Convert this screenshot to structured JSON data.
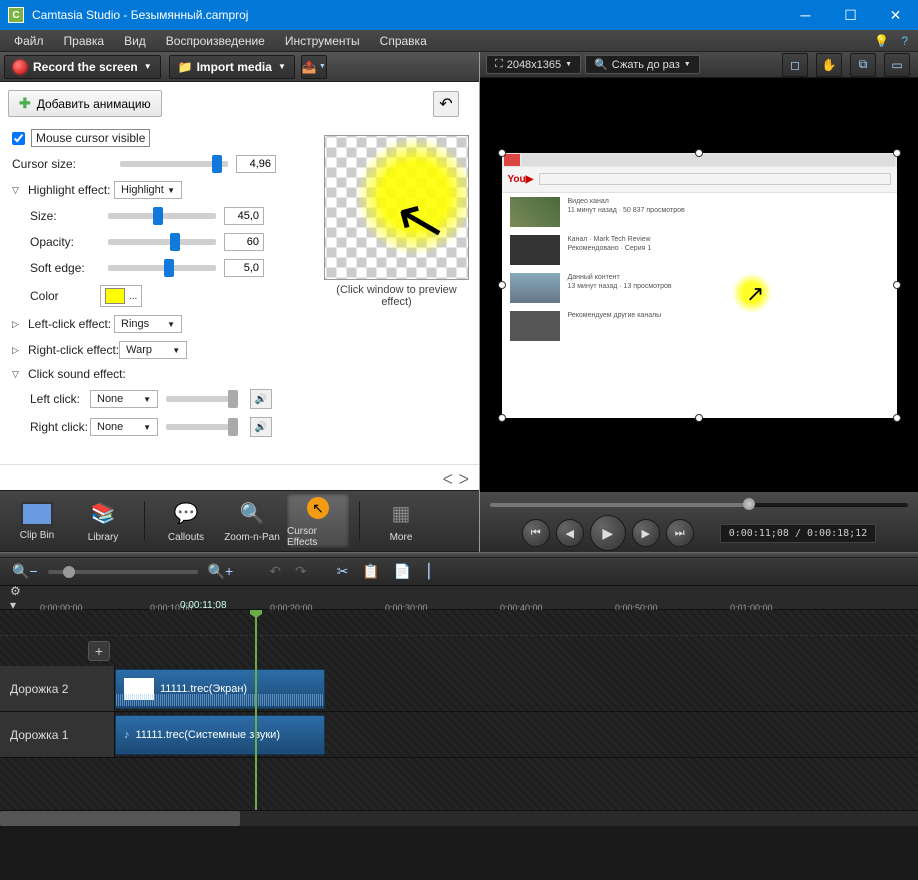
{
  "window": {
    "title": "Camtasia Studio - Безымянный.camproj"
  },
  "menu": {
    "items": [
      "Файл",
      "Правка",
      "Вид",
      "Воспроизведение",
      "Инструменты",
      "Справка"
    ]
  },
  "toolbar": {
    "record": "Record the screen",
    "import": "Import media"
  },
  "props": {
    "add_anim": "Добавить анимацию",
    "mouse_visible": "Mouse cursor visible",
    "cursor_size": "Cursor size:",
    "cursor_size_val": "4,96",
    "highlight_effect": "Highlight effect:",
    "highlight_sel": "Highlight",
    "size": "Size:",
    "size_val": "45,0",
    "opacity": "Opacity:",
    "opacity_val": "60",
    "soft_edge": "Soft edge:",
    "soft_edge_val": "5,0",
    "color": "Color",
    "left_click_effect": "Left-click effect:",
    "left_click_sel": "Rings",
    "right_click_effect": "Right-click effect:",
    "right_click_sel": "Warp",
    "click_sound_effect": "Click sound effect:",
    "left_click": "Left click:",
    "left_click_snd": "None",
    "right_click": "Right click:",
    "right_click_snd": "None",
    "preview_label": "(Click window to preview effect)"
  },
  "tooltabs": {
    "clipbin": "Clip Bin",
    "library": "Library",
    "callouts": "Callouts",
    "zoom": "Zoom-n-Pan",
    "cursor": "Cursor Effects",
    "more": "More"
  },
  "preview": {
    "dims": "2048x1365",
    "shrink": "Сжать до раз"
  },
  "playback": {
    "time": "0:00:11;08 / 0:00:18;12"
  },
  "ruler": {
    "playhead": "0:00:11;08",
    "ticks": [
      "0:00:00;00",
      "0:00:10;00",
      "0:00:20;00",
      "0:00:30;00",
      "0:00:40;00",
      "0:00:50;00",
      "0:01:00;00"
    ]
  },
  "tracks": {
    "t2": "Дорожка 2",
    "t1": "Дорожка 1",
    "clip2": "11111.trec(Экран)",
    "clip1": "11111.trec(Системные звуки)"
  }
}
